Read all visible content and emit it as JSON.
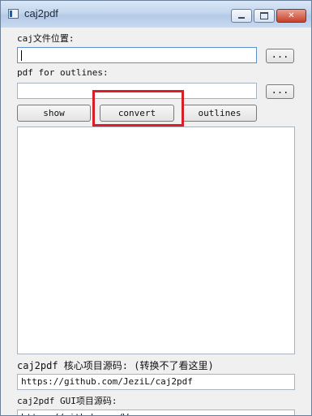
{
  "window": {
    "title": "caj2pdf"
  },
  "window_controls": {
    "minimize": "",
    "maximize": "",
    "close": "✕"
  },
  "caj_path": {
    "label": "caj文件位置:",
    "value": "",
    "browse_label": "..."
  },
  "outline_pdf": {
    "label": "pdf for outlines:",
    "value": "",
    "browse_label": "..."
  },
  "actions": {
    "show": "show",
    "convert": "convert",
    "outlines": "outlines"
  },
  "output": {
    "text": ""
  },
  "links": {
    "core_label": "caj2pdf 核心项目源码: (转换不了看这里)",
    "core_url": "https://github.com/JeziL/caj2pdf",
    "gui_label": "caj2pdf GUI项目源码:",
    "gui_url": "https://github.com/Wan..."
  },
  "colors": {
    "highlight": "#d81f27",
    "titlebar": "#c3d6ee",
    "close_button": "#c8402a"
  }
}
